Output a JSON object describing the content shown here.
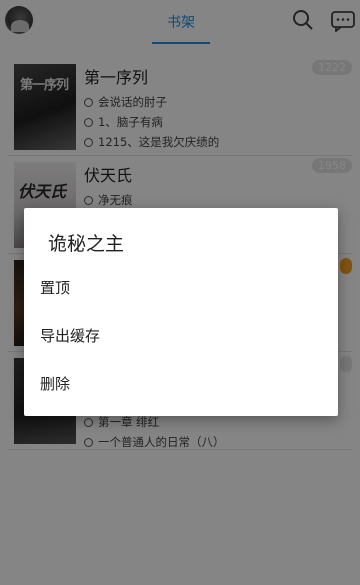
{
  "header": {
    "tab_label": "书架"
  },
  "books": [
    {
      "title": "第一序列",
      "author": "会说话的肘子",
      "latest": "1、脑子有病",
      "current": "1215、这是我欠庆绩的",
      "badge": "1222",
      "cover_text": "第一序列",
      "cover_sub": ""
    },
    {
      "title": "伏天氏",
      "author": "净无痕",
      "latest": "",
      "current": "",
      "badge": "1958",
      "cover_text": "伏天氏",
      "cover_sub": ""
    },
    {
      "title": "",
      "author": "",
      "latest": "",
      "current": "",
      "badge": "",
      "cover_text": "",
      "cover_sub": ""
    },
    {
      "title": "",
      "author": "",
      "latest": "第一章 绯红",
      "current": "一个普通人的日常（八）",
      "badge": "",
      "cover_text": "",
      "cover_sub": ""
    }
  ],
  "dialog": {
    "title": "诡秘之主",
    "items": [
      "置顶",
      "导出缓存",
      "删除"
    ]
  },
  "colors": {
    "accent": "#1d8fe0",
    "badge_orange": "#f5a020",
    "overlay": "rgba(0,0,0,0.48)"
  },
  "icons": [
    "avatar",
    "search-icon",
    "chat-icon",
    "author-icon",
    "clock-icon",
    "bookmark-icon"
  ]
}
